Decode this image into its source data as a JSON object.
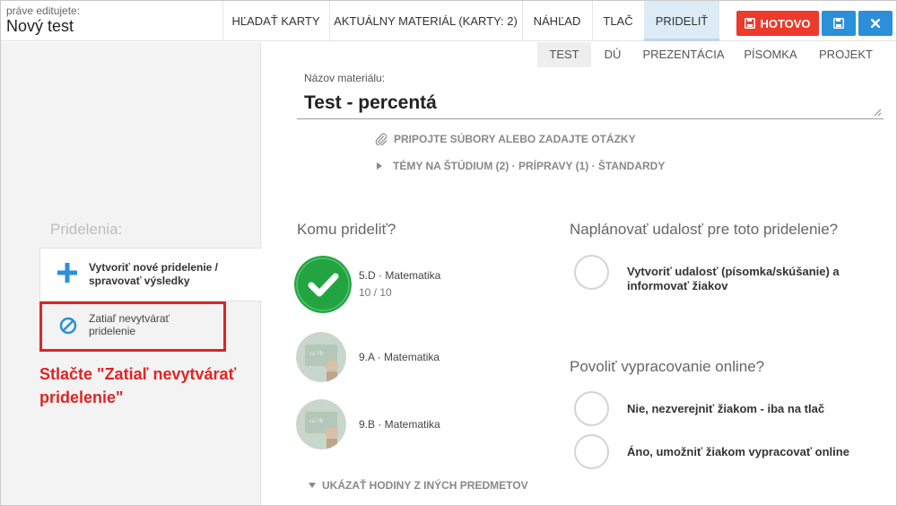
{
  "header": {
    "editing_label": "práve editujete:",
    "doc_title": "Nový test",
    "tabs": [
      {
        "label": "HĽADAŤ KARTY"
      },
      {
        "label": "AKTUÁLNY MATERIÁL (KARTY: 2)"
      },
      {
        "label": "NÁHĽAD"
      },
      {
        "label": "TLAČ"
      },
      {
        "label": "PRIDELIŤ",
        "active": true
      }
    ],
    "done_label": "HOTOVO"
  },
  "colors": {
    "done": "#ec3a2c",
    "primary": "#2b8fd9",
    "accent_red": "#e02424",
    "success": "#22a541"
  },
  "material_type_tabs": [
    {
      "label": "TEST",
      "active": true
    },
    {
      "label": "DÚ"
    },
    {
      "label": "PREZENTÁCIA"
    },
    {
      "label": "PÍSOMKA"
    },
    {
      "label": "PROJEKT"
    }
  ],
  "material": {
    "name_label": "Názov materiálu:",
    "name_value": "Test - percentá",
    "attach_label": "PRIPOJTE SÚBORY ALEBO ZADAJTE OTÁZKY",
    "topics_label": "TÉMY NA ŠTÚDIUM (2) · PRÍPRAVY (1) · ŠTANDARDY"
  },
  "left": {
    "heading": "Pridelenia:",
    "new_assignment": "Vytvoriť nové pridelenie / spravovať výsledky",
    "skip_assignment": "Zatiaľ nevytvárať pridelenie",
    "callout": "Stlačte \"Zatiaľ nevytvárať pridelenie\""
  },
  "assign": {
    "heading": "Komu prideliť?",
    "classes": [
      {
        "name": "5.D · Matematika",
        "count": "10 / 10",
        "selected": true
      },
      {
        "name": "9.A · Matematika"
      },
      {
        "name": "9.B · Matematika"
      }
    ],
    "show_more": "UKÁZAŤ HODINY Z INÝCH PREDMETOV"
  },
  "schedule": {
    "heading": "Naplánovať udalosť pre toto pridelenie?",
    "option": "Vytvoriť udalosť (písomka/skúšanie) a informovať žiakov"
  },
  "online": {
    "heading": "Povoliť vypracovanie online?",
    "options": [
      "Nie, nezverejniť žiakom - iba na tlač",
      "Áno, umožniť žiakom vypracovať online"
    ]
  }
}
